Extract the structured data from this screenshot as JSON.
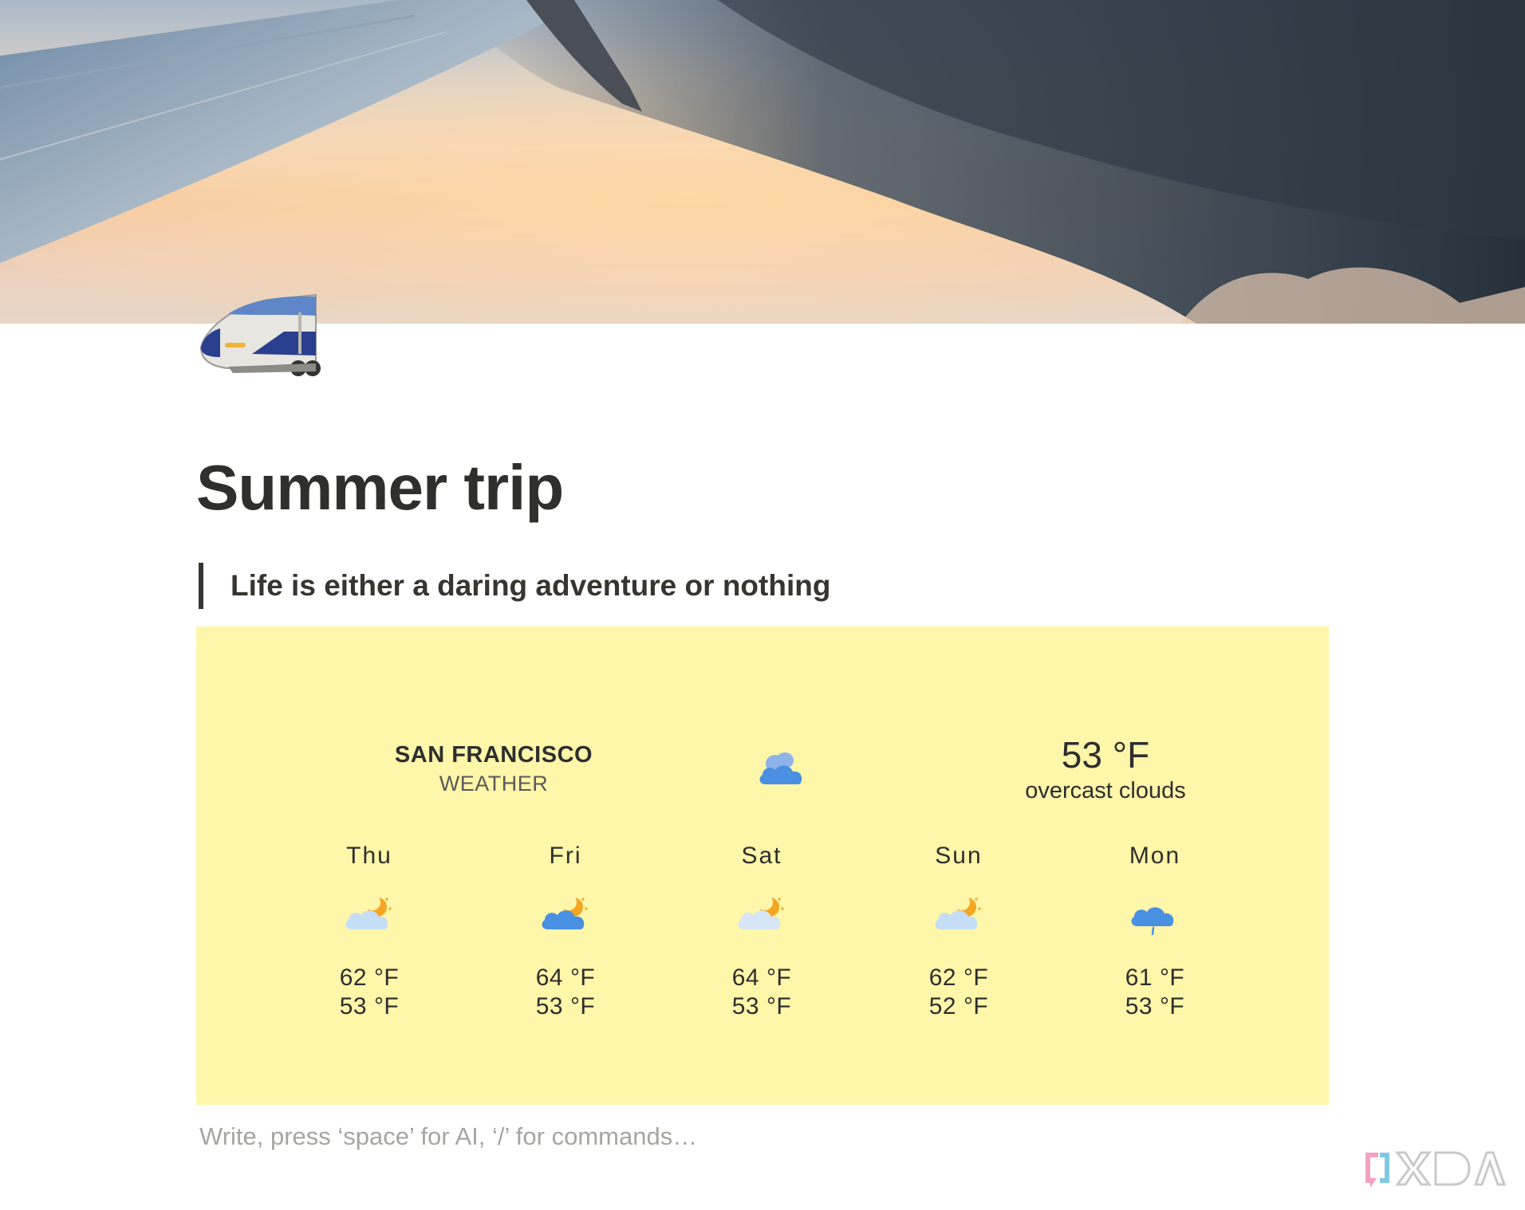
{
  "cover": {
    "image": "airplane-wing-sunset-sky"
  },
  "page_icon": "bullet-train-icon",
  "title": "Summer trip",
  "quote": "Life is either a daring adventure or nothing",
  "weather": {
    "city": "SAN FRANCISCO",
    "subtitle": "WEATHER",
    "current_icon": "cloud-icon",
    "current_temp": "53 °F",
    "current_desc": "overcast clouds",
    "forecast": [
      {
        "day": "Thu",
        "icon": "partly-cloudy-night-icon",
        "high": "62 °F",
        "low": "53 °F"
      },
      {
        "day": "Fri",
        "icon": "partly-cloudy-night-icon",
        "high": "64 °F",
        "low": "53 °F"
      },
      {
        "day": "Sat",
        "icon": "partly-cloudy-night-icon",
        "high": "64 °F",
        "low": "53 °F"
      },
      {
        "day": "Sun",
        "icon": "partly-cloudy-night-icon",
        "high": "62 °F",
        "low": "52 °F"
      },
      {
        "day": "Mon",
        "icon": "rain-cloud-icon",
        "high": "61 °F",
        "low": "53 °F"
      }
    ]
  },
  "editor": {
    "placeholder": "Write, press ‘space’ for AI, ‘/’ for commands…"
  },
  "watermark": {
    "text": "XDA"
  }
}
